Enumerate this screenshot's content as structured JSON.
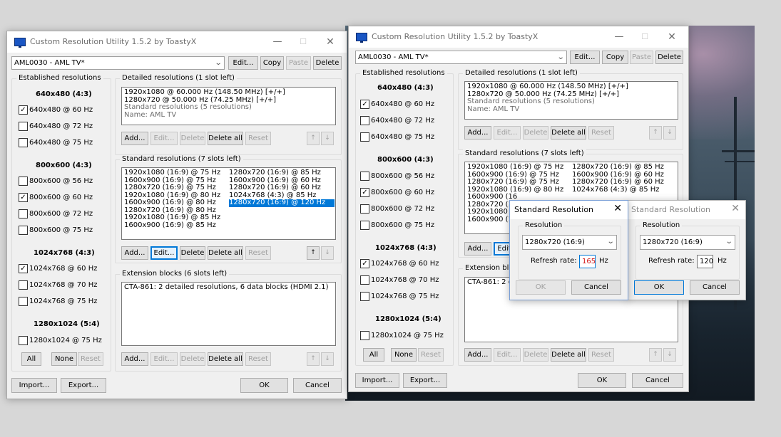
{
  "title": "Custom Resolution Utility 1.5.2 by ToastyX",
  "controls": {
    "min": "—",
    "max": "☐",
    "close": "✕"
  },
  "display_select": "AML0030 - AML TV*",
  "top_buttons": {
    "edit": "Edit...",
    "copy": "Copy",
    "paste": "Paste",
    "delete": "Delete"
  },
  "established": {
    "label": "Established resolutions",
    "groups": [
      {
        "header": "640x480 (4:3)",
        "items": [
          {
            "text": "640x480 @ 60 Hz",
            "checked": true
          },
          {
            "text": "640x480 @ 72 Hz",
            "checked": false
          },
          {
            "text": "640x480 @ 75 Hz",
            "checked": false
          }
        ]
      },
      {
        "header": "800x600 (4:3)",
        "items": [
          {
            "text": "800x600 @ 56 Hz",
            "checked": false
          },
          {
            "text": "800x600 @ 60 Hz",
            "checked": true
          },
          {
            "text": "800x600 @ 72 Hz",
            "checked": false
          },
          {
            "text": "800x600 @ 75 Hz",
            "checked": false
          }
        ]
      },
      {
        "header": "1024x768 (4:3)",
        "items": [
          {
            "text": "1024x768 @ 60 Hz",
            "checked": true
          },
          {
            "text": "1024x768 @ 70 Hz",
            "checked": false
          },
          {
            "text": "1024x768 @ 75 Hz",
            "checked": false
          }
        ]
      },
      {
        "header": "1280x1024 (5:4)",
        "items": [
          {
            "text": "1280x1024 @ 75 Hz",
            "checked": false
          }
        ]
      }
    ],
    "buttons": {
      "all": "All",
      "none": "None",
      "reset": "Reset"
    }
  },
  "detailed": {
    "label": "Detailed resolutions (1 slot left)",
    "items": [
      {
        "text": "1920x1080 @ 60.000 Hz (148.50 MHz) [+/+]",
        "gray": false
      },
      {
        "text": "1280x720 @ 50.000 Hz (74.25 MHz) [+/+]",
        "gray": false
      },
      {
        "text": "Standard resolutions (5 resolutions)",
        "gray": true
      },
      {
        "text": "Name: AML TV",
        "gray": true
      }
    ],
    "buttons": {
      "add": "Add...",
      "edit": "Edit...",
      "delete": "Delete",
      "delete_all": "Delete all",
      "reset": "Reset",
      "up": "↑",
      "down": "↓"
    }
  },
  "standard": {
    "label": "Standard resolutions (7 slots left)",
    "col1": [
      "1920x1080 (16:9) @ 75 Hz",
      "1600x900 (16:9) @ 75 Hz",
      "1280x720 (16:9) @ 75 Hz",
      "1920x1080 (16:9) @ 80 Hz",
      "1600x900 (16:9) @ 80 Hz",
      "1280x720 (16:9) @ 80 Hz",
      "1920x1080 (16:9) @ 85 Hz",
      "1600x900 (16:9) @ 85 Hz"
    ],
    "col2": [
      "1280x720 (16:9) @ 85 Hz",
      "1600x900 (16:9) @ 60 Hz",
      "1280x720 (16:9) @ 60 Hz",
      "1024x768 (4:3) @ 85 Hz",
      "1280x720 (16:9) @ 120 Hz"
    ],
    "right_col1": [
      "1920x1080 (16:9) @ 75 Hz",
      "1600x900 (16:9) @ 75 Hz",
      "1280x720 (16:9) @ 75 Hz",
      "1920x1080 (16:9) @ 80 Hz",
      "1600x900 (16",
      "1280x720 (1",
      "1920x1080 (",
      "1600x900 (16"
    ],
    "right_col2": [
      "1280x720 (16:9) @ 85 Hz",
      "1600x900 (16:9) @ 60 Hz",
      "1280x720 (16:9) @ 60 Hz",
      "1024x768 (4:3) @ 85 Hz"
    ],
    "buttons": {
      "add": "Add...",
      "edit": "Edit...",
      "edit_trunc": "Edit",
      "delete": "Delete",
      "delete_all": "Delete all",
      "reset": "Reset",
      "up": "↑",
      "down": "↓"
    }
  },
  "extension": {
    "label": "Extension blocks (6 slots left)",
    "label_trunc": "Extension bloc",
    "item": "CTA-861: 2 detailed resolutions, 6 data blocks (HDMI 2.1)",
    "item_trunc": "CTA-861: 2 d",
    "buttons": {
      "add": "Add...",
      "edit": "Edit...",
      "delete": "Delete",
      "delete_all": "Delete all",
      "reset": "Reset",
      "up": "↑",
      "down": "↓"
    }
  },
  "footer": {
    "import": "Import...",
    "export": "Export...",
    "ok": "OK",
    "cancel": "Cancel"
  },
  "dialog_active": {
    "title": "Standard Resolution",
    "resolution_label": "Resolution",
    "resolution": "1280x720 (16:9)",
    "refresh_label": "Refresh rate:",
    "refresh_value": "165",
    "hz": "Hz",
    "ok": "OK",
    "cancel": "Cancel"
  },
  "dialog_inactive": {
    "title": "Standard Resolution",
    "resolution_label": "Resolution",
    "resolution": "1280x720 (16:9)",
    "refresh_label": "Refresh rate:",
    "refresh_value": "120",
    "hz": "Hz",
    "ok": "OK",
    "cancel": "Cancel"
  }
}
